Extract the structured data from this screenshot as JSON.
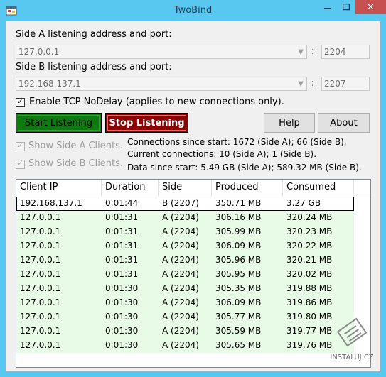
{
  "window": {
    "title": "TwoBind",
    "close_label": "✕"
  },
  "sideA": {
    "label": "Side A listening address and port:",
    "address": "127.0.0.1",
    "port": "2204"
  },
  "sideB": {
    "label": "Side B listening address and port:",
    "address": "192.168.137.1",
    "port": "2207"
  },
  "colon": ":",
  "nodelay": {
    "label": "Enable TCP NoDelay (applies to new connections only).",
    "checked": true
  },
  "buttons": {
    "start": "Start Listening",
    "stop": "Stop Listening",
    "help": "Help",
    "about": "About"
  },
  "show": {
    "a": "Show Side A Clients.",
    "b": "Show Side B Clients."
  },
  "stats": {
    "connections": "Connections since start: 1672 (Side A); 66 (Side B).",
    "current": "Current connections: 10 (Side A); 1 (Side B).",
    "data": "Data since start: 5.49 GB (Side A); 589.32 MB (Side B)."
  },
  "table": {
    "columns": [
      "Client IP",
      "Duration",
      "Side",
      "Produced",
      "Consumed"
    ],
    "rows": [
      [
        "192.168.137.1",
        "0:01:44",
        "B (2207)",
        "350.71 MB",
        "3.27 GB"
      ],
      [
        "127.0.0.1",
        "0:01:31",
        "A (2204)",
        "306.16 MB",
        "320.24 MB"
      ],
      [
        "127.0.0.1",
        "0:01:31",
        "A (2204)",
        "305.99 MB",
        "320.23 MB"
      ],
      [
        "127.0.0.1",
        "0:01:31",
        "A (2204)",
        "306.09 MB",
        "320.22 MB"
      ],
      [
        "127.0.0.1",
        "0:01:31",
        "A (2204)",
        "305.96 MB",
        "320.21 MB"
      ],
      [
        "127.0.0.1",
        "0:01:31",
        "A (2204)",
        "305.95 MB",
        "320.02 MB"
      ],
      [
        "127.0.0.1",
        "0:01:30",
        "A (2204)",
        "305.35 MB",
        "319.88 MB"
      ],
      [
        "127.0.0.1",
        "0:01:30",
        "A (2204)",
        "306.09 MB",
        "319.86 MB"
      ],
      [
        "127.0.0.1",
        "0:01:30",
        "A (2204)",
        "305.77 MB",
        "319.80 MB"
      ],
      [
        "127.0.0.1",
        "0:01:30",
        "A (2204)",
        "305.59 MB",
        "319.77 MB"
      ],
      [
        "127.0.0.1",
        "0:01:30",
        "A (2204)",
        "305.65 MB",
        "319.76 MB"
      ]
    ],
    "row_colors": {
      "side_b": "#ffffff",
      "side_a": "#e8fbe6"
    }
  },
  "watermark": "INSTALUJ.CZ"
}
